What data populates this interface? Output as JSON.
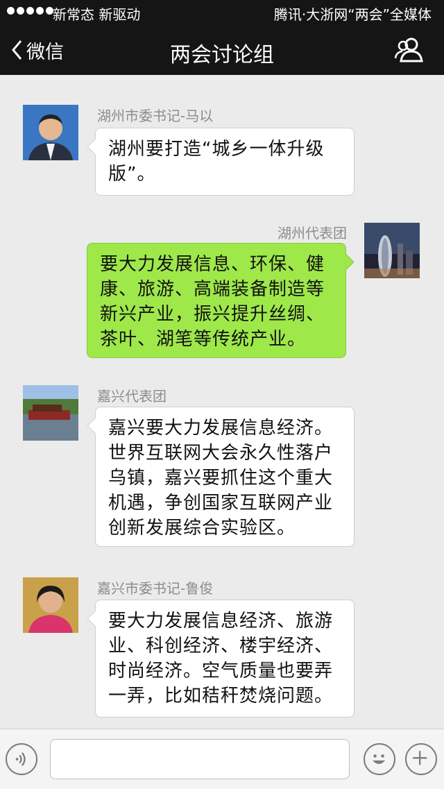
{
  "status_bar": {
    "carrier": "新常态 新驱动",
    "right_text": "腾讯·大浙网“两会”全媒体"
  },
  "nav": {
    "back_label": "微信",
    "title": "两会讨论组",
    "contacts_icon": "contacts-icon"
  },
  "messages": [
    {
      "sender": "湖州市委书记-马以",
      "side": "left",
      "text": "湖州要打造“城乡一体升级版”。",
      "avatar_icon": "portrait-avatar"
    },
    {
      "sender": "湖州代表团",
      "side": "right",
      "text": "要大力发展信息、环保、健康、旅游、高端装备制造等新兴产业，振兴提升丝绸、茶叶、湖笔等传统产业。",
      "avatar_icon": "skyline-avatar"
    },
    {
      "sender": "嘉兴代表团",
      "side": "left",
      "text": "嘉兴要大力发展信息经济。世界互联网大会永久性落户乌镇，嘉兴要抓住这个重大机遇，争创国家互联网产业创新发展综合实验区。",
      "avatar_icon": "red-boat-avatar"
    },
    {
      "sender": "嘉兴市委书记-鲁俊",
      "side": "left",
      "text": "要大力发展信息经济、旅游业、科创经济、楼宇经济、时尚经济。空气质量也要弄一弄，比如秸秆焚烧问题。",
      "avatar_icon": "portrait-avatar"
    }
  ],
  "input_bar": {
    "voice_icon": "voice-icon",
    "emoji_icon": "emoji-icon",
    "plus_icon": "plus-icon",
    "value": ""
  },
  "colors": {
    "topbar": "#151515",
    "background": "#ebebeb",
    "green_bubble": "#9ee84a",
    "white_bubble": "#ffffff"
  }
}
